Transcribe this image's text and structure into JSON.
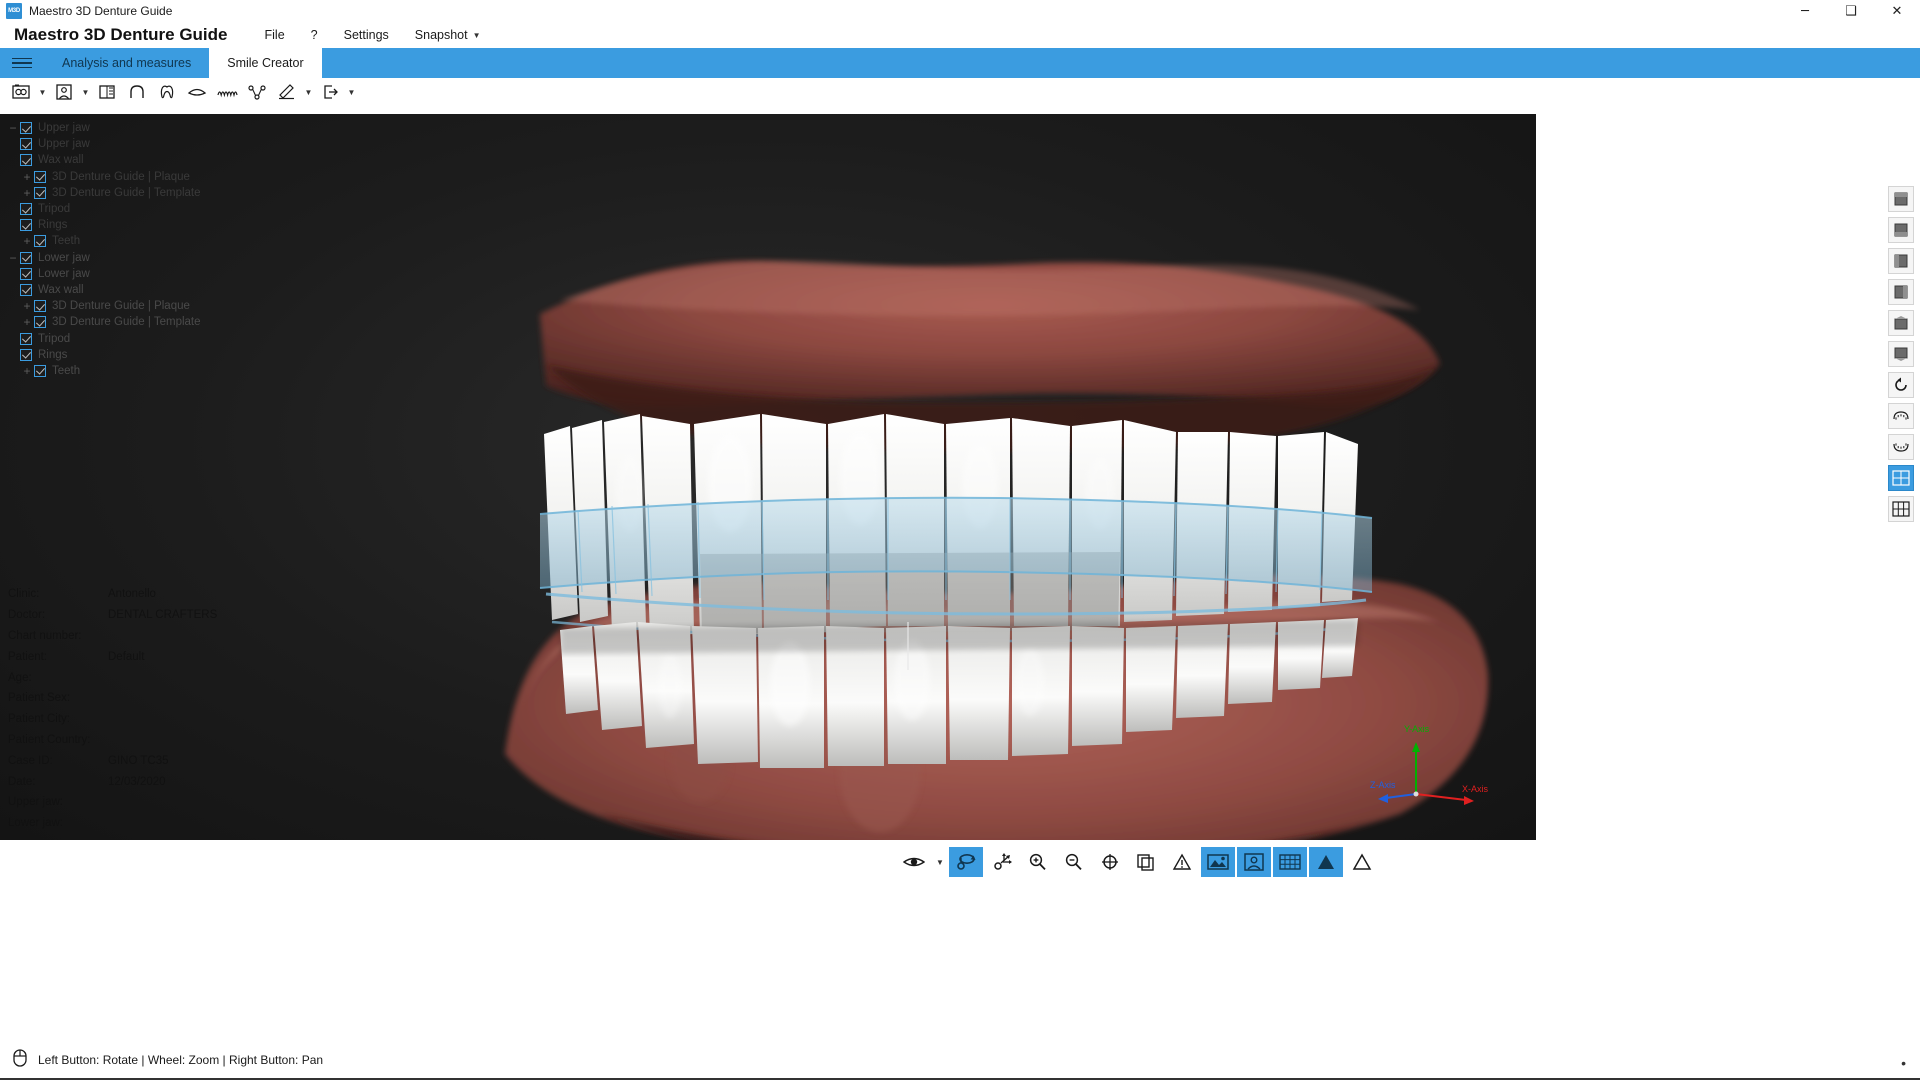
{
  "window": {
    "title": "Maestro 3D Denture Guide",
    "icon": "app-icon",
    "minimize": "─",
    "maximize": "❑",
    "close": "✕"
  },
  "menubar": {
    "app_title": "Maestro 3D Denture Guide",
    "items": [
      {
        "label": "File",
        "caret": ""
      },
      {
        "label": "?",
        "caret": ""
      },
      {
        "label": "Settings",
        "caret": ""
      },
      {
        "label": "Snapshot",
        "caret": "▼"
      }
    ]
  },
  "tabs": {
    "menu_icon": "hamburger-icon",
    "items": [
      {
        "label": "Analysis and measures",
        "active": false
      },
      {
        "label": "Smile Creator",
        "active": true
      }
    ]
  },
  "toolbar": {
    "items": [
      {
        "name": "open-project-icon",
        "caret": true
      },
      {
        "name": "patient-photo-icon",
        "caret": true
      },
      {
        "name": "image-calibration-icon",
        "caret": false
      },
      {
        "name": "arch-curve-icon",
        "caret": false
      },
      {
        "name": "tooth-library-icon",
        "caret": false
      },
      {
        "name": "lip-line-icon",
        "caret": false
      },
      {
        "name": "gum-wave-icon",
        "caret": false
      },
      {
        "name": "articulation-icon",
        "caret": false
      },
      {
        "name": "pencil-edit-icon",
        "caret": true
      },
      {
        "name": "export-icon",
        "caret": true
      }
    ]
  },
  "tree": {
    "items": [
      {
        "label": "Upper jaw",
        "depth": 0,
        "expander": "−",
        "checked": true,
        "dim": true
      },
      {
        "label": "Upper jaw",
        "depth": 1,
        "expander": "",
        "checked": true,
        "dim": true
      },
      {
        "label": "Wax wall",
        "depth": 1,
        "expander": "",
        "checked": true,
        "dim": true
      },
      {
        "label": "3D Denture Guide | Plaque",
        "depth": 2,
        "expander": "+",
        "checked": true,
        "dim": true
      },
      {
        "label": "3D Denture Guide | Template",
        "depth": 2,
        "expander": "+",
        "checked": true,
        "dim": true
      },
      {
        "label": "Tripod",
        "depth": 1,
        "expander": "",
        "checked": true,
        "dim": true
      },
      {
        "label": "Rings",
        "depth": 1,
        "expander": "",
        "checked": true,
        "dim": true
      },
      {
        "label": "Teeth",
        "depth": 2,
        "expander": "+",
        "checked": true,
        "dim": true
      },
      {
        "label": "Lower jaw",
        "depth": 0,
        "expander": "−",
        "checked": true,
        "dim": false
      },
      {
        "label": "Lower jaw",
        "depth": 1,
        "expander": "",
        "checked": true,
        "dim": false
      },
      {
        "label": "Wax wall",
        "depth": 1,
        "expander": "",
        "checked": true,
        "dim": false
      },
      {
        "label": "3D Denture Guide | Plaque",
        "depth": 2,
        "expander": "+",
        "checked": true,
        "dim": false
      },
      {
        "label": "3D Denture Guide | Template",
        "depth": 2,
        "expander": "+",
        "checked": true,
        "dim": false
      },
      {
        "label": "Tripod",
        "depth": 1,
        "expander": "",
        "checked": true,
        "dim": false
      },
      {
        "label": "Rings",
        "depth": 1,
        "expander": "",
        "checked": true,
        "dim": false
      },
      {
        "label": "Teeth",
        "depth": 2,
        "expander": "+",
        "checked": true,
        "dim": false
      }
    ]
  },
  "info": {
    "rows": [
      {
        "key": "Clinic:",
        "value": "Antonello"
      },
      {
        "key": "Doctor:",
        "value": "DENTAL CRAFTERS"
      },
      {
        "key": "Chart number:",
        "value": ""
      },
      {
        "key": "Patient:",
        "value": "Default"
      },
      {
        "key": "Age:",
        "value": ""
      },
      {
        "key": "Patient Sex:",
        "value": ""
      },
      {
        "key": "Patient City:",
        "value": ""
      },
      {
        "key": "Patient Country:",
        "value": ""
      },
      {
        "key": "Case  ID:",
        "value": "GINO TC35"
      },
      {
        "key": "Date:",
        "value": "12/03/2020"
      },
      {
        "key": "Upper jaw:",
        "value": ""
      },
      {
        "key": "Lower jaw:",
        "value": ""
      }
    ]
  },
  "right_toolbar": {
    "items": [
      {
        "name": "view-front-icon",
        "active": false
      },
      {
        "name": "view-back-icon",
        "active": false
      },
      {
        "name": "view-left-icon",
        "active": false
      },
      {
        "name": "view-right-icon",
        "active": false
      },
      {
        "name": "view-top-icon",
        "active": false
      },
      {
        "name": "view-bottom-icon",
        "active": false
      },
      {
        "name": "reset-rotation-icon",
        "active": false
      },
      {
        "name": "occlusal-upper-icon",
        "active": false
      },
      {
        "name": "occlusal-lower-icon",
        "active": false
      },
      {
        "name": "multi-view-icon",
        "active": true
      },
      {
        "name": "grid-view-icon",
        "active": false
      }
    ]
  },
  "bottom_toolbar": {
    "items": [
      {
        "name": "eye-visibility-icon",
        "active": false,
        "caret": true
      },
      {
        "name": "rotate-tool-icon",
        "active": true,
        "caret": false
      },
      {
        "name": "pan-tool-icon",
        "active": false,
        "caret": false
      },
      {
        "name": "zoom-in-icon",
        "active": false,
        "caret": false
      },
      {
        "name": "zoom-out-icon",
        "active": false,
        "caret": false
      },
      {
        "name": "zoom-fit-icon",
        "active": false,
        "caret": false
      },
      {
        "name": "copy-view-icon",
        "active": false,
        "caret": false
      },
      {
        "name": "warning-triangle-icon",
        "active": false,
        "caret": false
      },
      {
        "name": "screenshot-icon",
        "active": true,
        "caret": false
      },
      {
        "name": "patient-view-icon",
        "active": true,
        "caret": false
      },
      {
        "name": "grid-overlay-icon",
        "active": true,
        "caret": false
      },
      {
        "name": "triangle-mesh-icon",
        "active": true,
        "caret": false
      },
      {
        "name": "outline-mesh-icon",
        "active": false,
        "caret": false
      }
    ]
  },
  "statusbar": {
    "mouse_icon": "mouse-icon",
    "text": "Left Button: Rotate | Wheel: Zoom | Right Button: Pan",
    "overflow": "•"
  },
  "gizmo": {
    "y_label": "Y-Axis",
    "x_label": "X-Axis",
    "z_label": "Z-Axis",
    "y_color": "#00b200",
    "x_color": "#e02020",
    "z_color": "#2060e0"
  },
  "colors": {
    "accent": "#3b9ce0",
    "tab_text": "#10364f",
    "viewport_bg": "#1c1c1c",
    "gum": "#8b4a42",
    "tooth": "#f2f2f0",
    "wax_wall": "#8fc4e0"
  }
}
